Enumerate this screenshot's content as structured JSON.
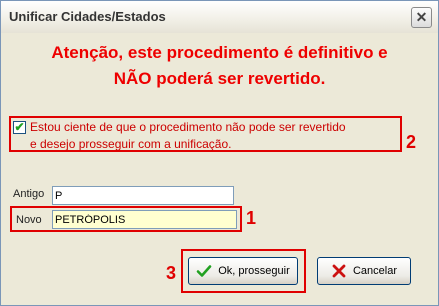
{
  "window": {
    "title": "Unificar Cidades/Estados",
    "close_glyph": "✕"
  },
  "warning": {
    "line1": "Atenção, este procedimento é definitivo e",
    "line2": "NÃO poderá ser revertido."
  },
  "confirm": {
    "checked": true,
    "line1": "Estou ciente de que o procedimento não pode ser revertido",
    "line2": "e desejo prosseguir com a unificação."
  },
  "fields": {
    "antigo_label": "Antigo",
    "antigo_value": "P",
    "novo_label": "Novo",
    "novo_value": "PETRÓPOLIS"
  },
  "buttons": {
    "ok_label": "Ok, prosseguir",
    "ok_icon": "check-icon",
    "cancel_label": "Cancelar",
    "cancel_icon": "x-icon"
  },
  "annotations": {
    "marker1": "1",
    "marker2": "2",
    "marker3": "3"
  },
  "colors": {
    "warning_text": "#ee0000",
    "annotation_border": "#e00000",
    "check_green": "#21a121",
    "highlight_field": "#ffffd0"
  }
}
